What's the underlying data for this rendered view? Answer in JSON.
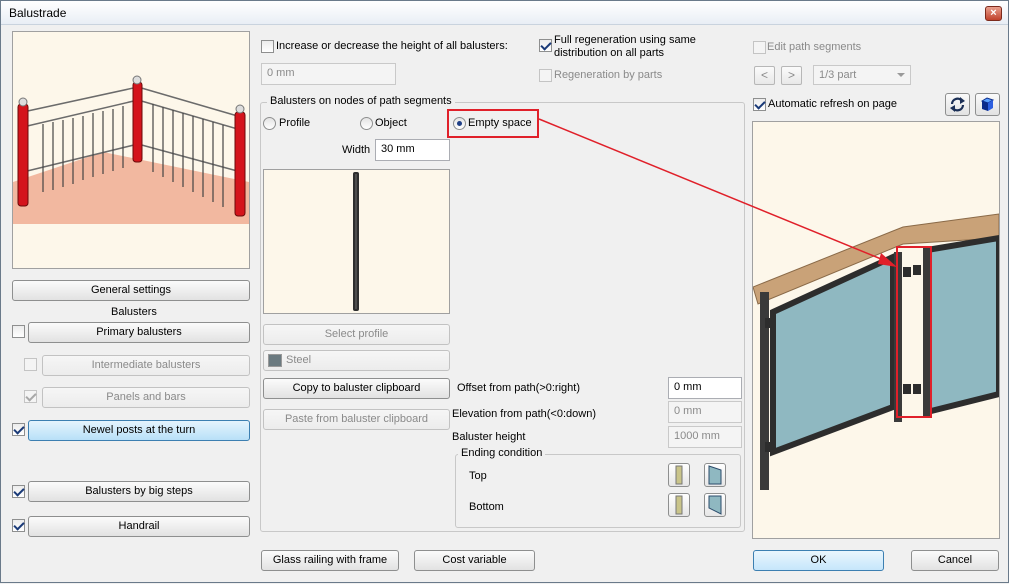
{
  "window": {
    "title": "Balustrade",
    "close": "×"
  },
  "left": {
    "general_settings": "General settings",
    "balusters_heading": "Balusters",
    "primary_balusters": "Primary balusters",
    "intermediate_balusters": "Intermediate balusters",
    "panels_and_bars": "Panels and bars",
    "newel_posts": "Newel posts at the turn",
    "big_steps": "Balusters by big steps",
    "handrail": "Handrail",
    "checks": {
      "primary": false,
      "intermediate": false,
      "panels": true,
      "newel": true,
      "big_steps": true,
      "handrail": true
    }
  },
  "middle": {
    "increase_height_label": "Increase or decrease the height of all balusters:",
    "increase_height_value": "0 mm",
    "full_regen_label_1": "Full regeneration using same",
    "full_regen_label_2": "distribution on all parts",
    "regen_by_parts_label": "Regeneration by parts",
    "nodes_group_label": "Balusters on nodes of path segments",
    "radio_profile": "Profile",
    "radio_object": "Object",
    "radio_empty": "Empty space",
    "width_label": "Width",
    "width_value": "30 mm",
    "select_profile": "Select profile",
    "material": "Steel",
    "copy_clipboard": "Copy to baluster clipboard",
    "paste_clipboard": "Paste from baluster clipboard",
    "offset_label": "Offset from path(>0:right)",
    "offset_value": "0 mm",
    "elevation_label": "Elevation from path(<0:down)",
    "elevation_value": "0 mm",
    "height_label": "Baluster height",
    "height_value": "1000 mm",
    "ending_group_label": "Ending condition",
    "ending_top": "Top",
    "ending_bottom": "Bottom"
  },
  "right": {
    "edit_path_label": "Edit path segments",
    "prev": "<",
    "next": ">",
    "part_value": "1/3 part",
    "auto_refresh_label": "Automatic refresh on page"
  },
  "footer": {
    "glass_railing": "Glass railing with frame",
    "cost_variable": "Cost variable",
    "ok": "OK",
    "cancel": "Cancel"
  },
  "colors": {
    "annotation_red": "#e0202a",
    "preview_background": "#fdf7ea",
    "glass": "#8fb8c1",
    "handrail_wood": "#c9a278",
    "post_red": "#d4141c"
  }
}
